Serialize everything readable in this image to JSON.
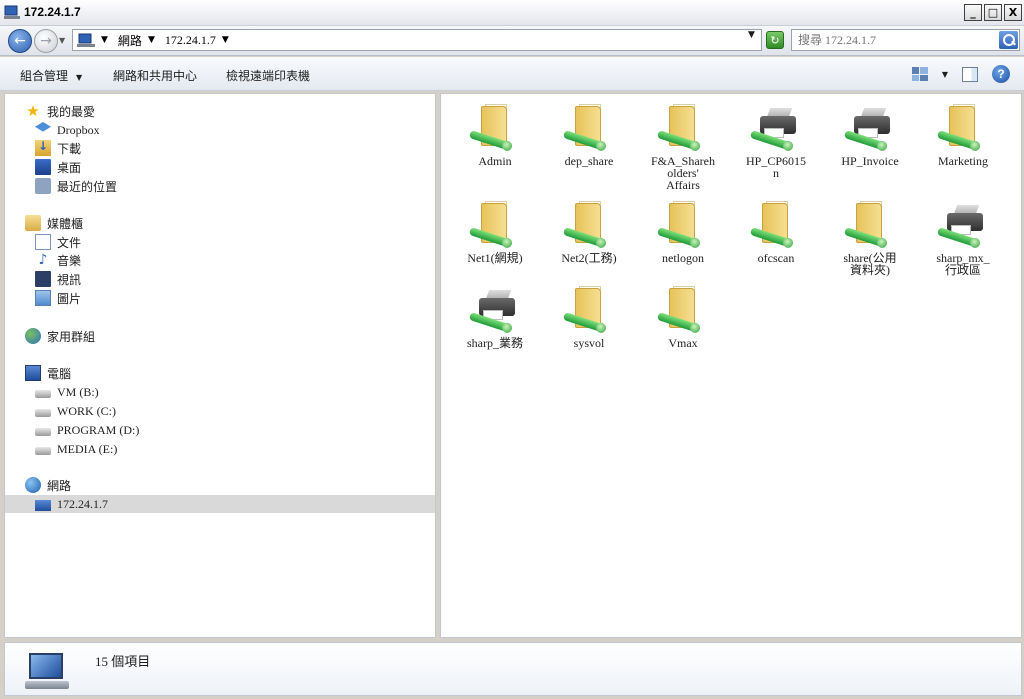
{
  "window": {
    "title": "172.24.1.7"
  },
  "address": {
    "breadcrumbs": [
      "網路",
      "172.24.1.7"
    ]
  },
  "search": {
    "placeholder": "搜尋 172.24.1.7"
  },
  "toolbar": {
    "organize": "組合管理",
    "network_center": "網路和共用中心",
    "printers": "檢視遠端印表機"
  },
  "nav": {
    "favorites": "我的最愛",
    "dropbox": "Dropbox",
    "downloads": "下載",
    "desktop": "桌面",
    "recent": "最近的位置",
    "libraries": "媒體櫃",
    "documents": "文件",
    "music": "音樂",
    "videos": "視訊",
    "pictures": "圖片",
    "homegroup": "家用群組",
    "computer": "電腦",
    "drive_b": "VM (B:)",
    "drive_c": "WORK (C:)",
    "drive_d": "PROGRAM (D:)",
    "drive_e": "MEDIA (E:)",
    "network": "網路",
    "host": "172.24.1.7"
  },
  "items": [
    {
      "label": "Admin",
      "type": "share"
    },
    {
      "label": "dep_share",
      "type": "share"
    },
    {
      "label": "F&A_Shareh\nolders'\nAffairs",
      "type": "share"
    },
    {
      "label": "HP_CP6015\nn",
      "type": "printer"
    },
    {
      "label": "HP_Invoice",
      "type": "printer"
    },
    {
      "label": "Marketing",
      "type": "share"
    },
    {
      "label": "Net1(網規)",
      "type": "share"
    },
    {
      "label": "Net2(工務)",
      "type": "share"
    },
    {
      "label": "netlogon",
      "type": "share"
    },
    {
      "label": "ofcscan",
      "type": "share"
    },
    {
      "label": "share(公用\n資料夾)",
      "type": "share"
    },
    {
      "label": "sharp_mx_\n行政區",
      "type": "printer"
    },
    {
      "label": "sharp_業務",
      "type": "printer"
    },
    {
      "label": "sysvol",
      "type": "share"
    },
    {
      "label": "Vmax",
      "type": "share"
    }
  ],
  "details": {
    "count": "15 個項目"
  },
  "colors": {
    "titlebar": "#e3e6ec",
    "selection": "#d9d9d9",
    "accent": "#2f63b3"
  }
}
